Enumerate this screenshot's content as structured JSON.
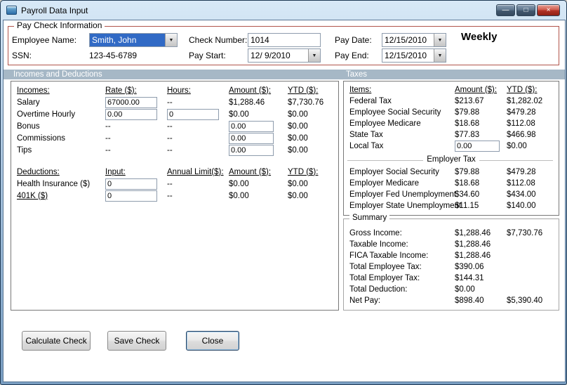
{
  "window": {
    "title": "Payroll Data Input",
    "minimize_glyph": "—",
    "maximize_glyph": "□",
    "close_glyph": "×"
  },
  "paycheck_info": {
    "group_label": "Pay Check Information",
    "employee_name_label": "Employee Name:",
    "employee_name_value": "Smith, John",
    "ssn_label": "SSN:",
    "ssn_value": "123-45-6789",
    "check_number_label": "Check Number:",
    "check_number_value": "1014",
    "pay_start_label": "Pay Start:",
    "pay_start_value": "12/ 9/2010",
    "pay_date_label": "Pay Date:",
    "pay_date_value": "12/15/2010",
    "pay_end_label": "Pay End:",
    "pay_end_value": "12/15/2010",
    "frequency": "Weekly"
  },
  "sections": {
    "left": "Incomes and Deductions",
    "right": "Taxes"
  },
  "incomes": {
    "header": {
      "label": "Incomes:",
      "rate": "Rate ($):",
      "hours": "Hours:",
      "amount": "Amount ($):",
      "ytd": "YTD ($):"
    },
    "rows": [
      {
        "label": "Salary",
        "rate": "67000.00",
        "hours": "--",
        "amount": "$1,288.46",
        "ytd": "$7,730.76"
      },
      {
        "label": "Overtime Hourly",
        "rate": "0.00",
        "hours": "0",
        "amount": "$0.00",
        "ytd": "$0.00"
      },
      {
        "label": "Bonus",
        "rate": "--",
        "hours": "--",
        "amount": "0.00",
        "ytd": "$0.00"
      },
      {
        "label": "Commissions",
        "rate": "--",
        "hours": "--",
        "amount": "0.00",
        "ytd": "$0.00"
      },
      {
        "label": "Tips",
        "rate": "--",
        "hours": "--",
        "amount": "0.00",
        "ytd": "$0.00"
      }
    ]
  },
  "deductions": {
    "header": {
      "label": "Deductions:",
      "input": "Input:",
      "limit": "Annual Limit($):",
      "amount": "Amount ($):",
      "ytd": "YTD ($):"
    },
    "rows": [
      {
        "label": "Health Insurance ($)",
        "input": "0",
        "limit": "--",
        "amount": "$0.00",
        "ytd": "$0.00"
      },
      {
        "label": "401K ($)",
        "input": "0",
        "limit": "--",
        "amount": "$0.00",
        "ytd": "$0.00"
      }
    ]
  },
  "taxes": {
    "header": {
      "items": "Items:",
      "amount": "Amount ($):",
      "ytd": "YTD ($):"
    },
    "rows": [
      {
        "label": "Federal Tax",
        "amount": "$213.67",
        "ytd": "$1,282.02"
      },
      {
        "label": "Employee Social Security",
        "amount": "$79.88",
        "ytd": "$479.28"
      },
      {
        "label": "Employee Medicare",
        "amount": "$18.68",
        "ytd": "$112.08"
      },
      {
        "label": "State Tax",
        "amount": "$77.83",
        "ytd": "$466.98"
      },
      {
        "label": "Local Tax",
        "amount": "0.00",
        "ytd": "$0.00"
      }
    ],
    "employer_label": "Employer Tax",
    "employer_rows": [
      {
        "label": "Employer Social Security",
        "amount": "$79.88",
        "ytd": "$479.28"
      },
      {
        "label": "Employer Medicare",
        "amount": "$18.68",
        "ytd": "$112.08"
      },
      {
        "label": "Employer Fed Unemployment",
        "amount": "$34.60",
        "ytd": "$434.00"
      },
      {
        "label": "Employer State Unemployment",
        "amount": "$11.15",
        "ytd": "$140.00"
      }
    ]
  },
  "summary": {
    "group_label": "Summary",
    "rows": [
      {
        "label": "Gross Income:",
        "amount": "$1,288.46",
        "ytd": "$7,730.76"
      },
      {
        "label": "Taxable Income:",
        "amount": "$1,288.46",
        "ytd": ""
      },
      {
        "label": "FICA Taxable Income:",
        "amount": "$1,288.46",
        "ytd": ""
      },
      {
        "label": "Total Employee Tax:",
        "amount": "$390.06",
        "ytd": ""
      },
      {
        "label": "Total Employer Tax:",
        "amount": "$144.31",
        "ytd": ""
      },
      {
        "label": "Total Deduction:",
        "amount": "$0.00",
        "ytd": ""
      },
      {
        "label": "Net Pay:",
        "amount": "$898.40",
        "ytd": "$5,390.40"
      }
    ]
  },
  "buttons": {
    "calculate": "Calculate Check",
    "save": "Save Check",
    "close": "Close"
  },
  "colors": {
    "section_band": "#a6b8c6",
    "group_border": "#b1544a",
    "selection_bg": "#316ac5",
    "selection_text": "#ffffff"
  }
}
